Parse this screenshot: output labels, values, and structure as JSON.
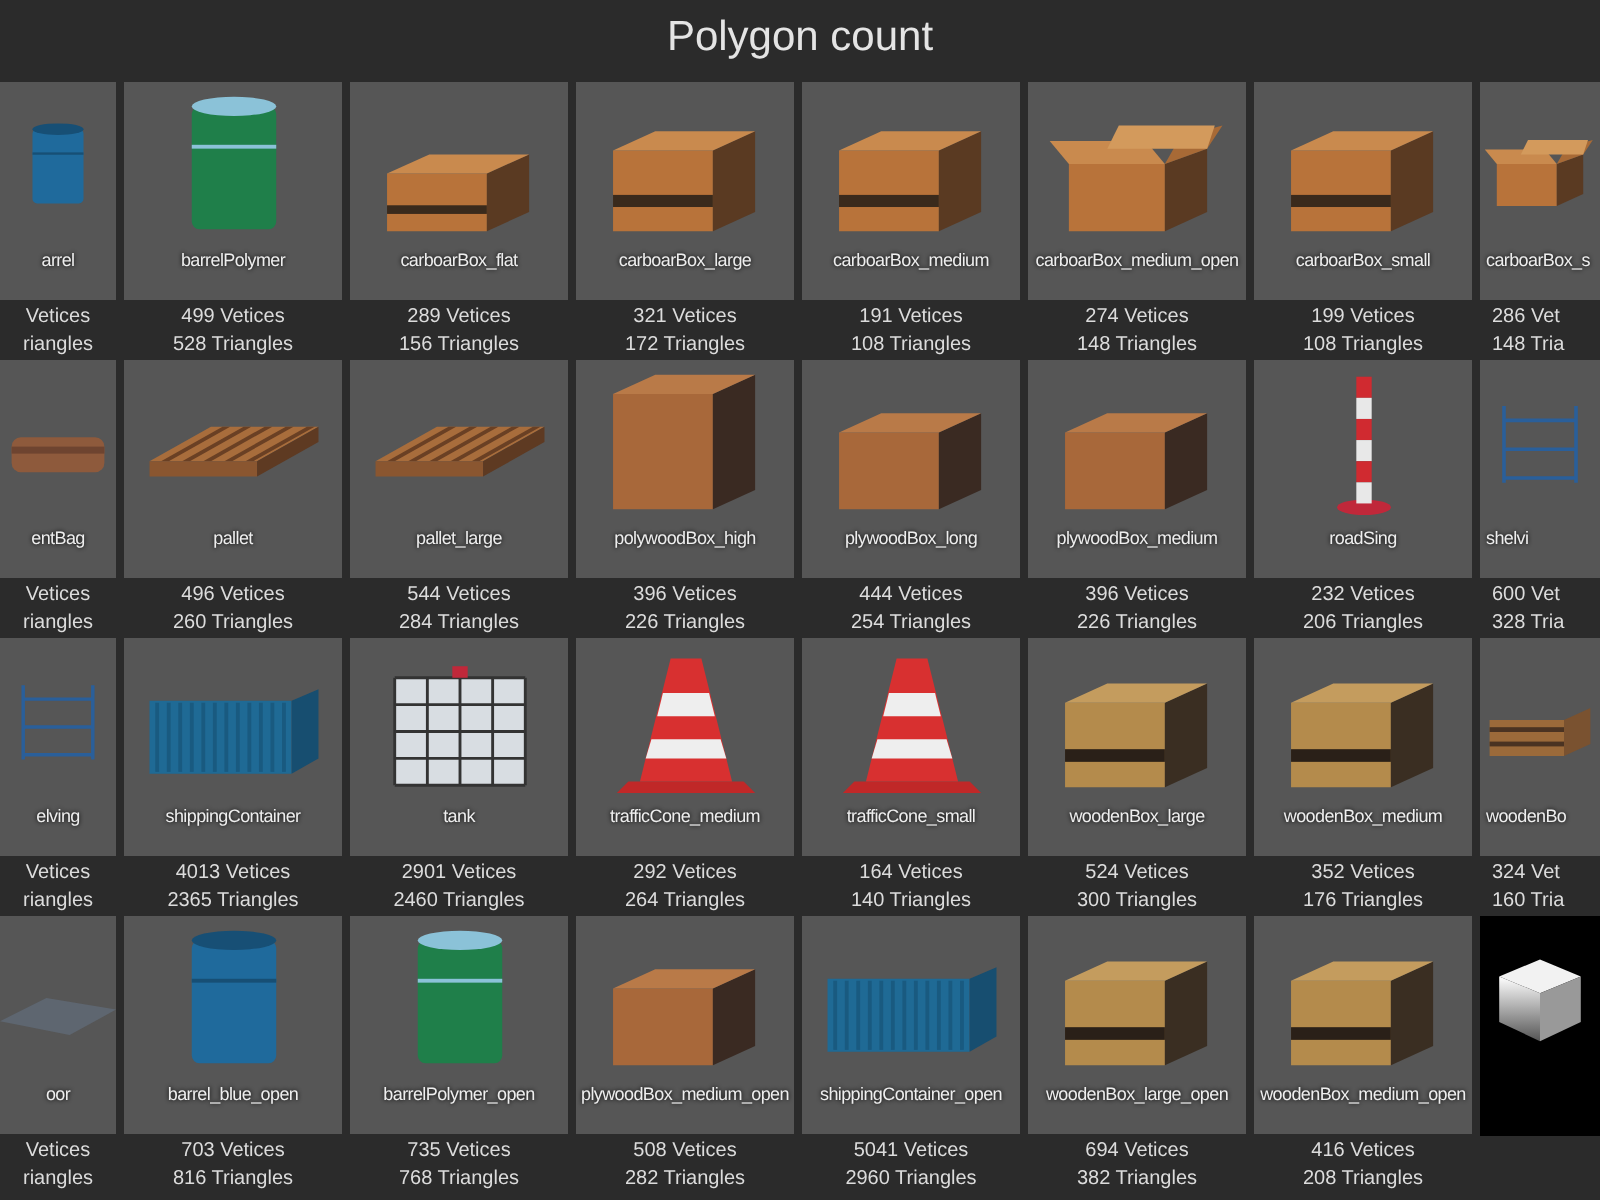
{
  "title": "Polygon count",
  "rows": [
    [
      {
        "kind": "barrel",
        "name": "arrel",
        "vertices": "Vetices",
        "triangles": "riangles"
      },
      {
        "kind": "drum",
        "name": "barrelPolymer",
        "vertices": "499 Vetices",
        "triangles": "528 Triangles"
      },
      {
        "kind": "flatbox",
        "name": "carboarBox_flat",
        "vertices": "289 Vetices",
        "triangles": "156 Triangles"
      },
      {
        "kind": "box",
        "name": "carboarBox_large",
        "vertices": "321 Vetices",
        "triangles": "172 Triangles"
      },
      {
        "kind": "box",
        "name": "carboarBox_medium",
        "vertices": "191 Vetices",
        "triangles": "108 Triangles"
      },
      {
        "kind": "openbox",
        "name": "carboarBox_medium_open",
        "vertices": "274 Vetices",
        "triangles": "148 Triangles"
      },
      {
        "kind": "box",
        "name": "carboarBox_small",
        "vertices": "199 Vetices",
        "triangles": "108 Triangles"
      },
      {
        "kind": "openbox",
        "name": "carboarBox_s",
        "vertices": "286 Vet",
        "triangles": "148 Tria"
      }
    ],
    [
      {
        "kind": "bag",
        "name": "entBag",
        "vertices": "Vetices",
        "triangles": "riangles"
      },
      {
        "kind": "pallet",
        "name": "pallet",
        "vertices": "496 Vetices",
        "triangles": "260 Triangles"
      },
      {
        "kind": "pallet",
        "name": "pallet_large",
        "vertices": "544 Vetices",
        "triangles": "284 Triangles"
      },
      {
        "kind": "tallcrate",
        "name": "polywoodBox_high",
        "vertices": "396 Vetices",
        "triangles": "226 Triangles"
      },
      {
        "kind": "crate",
        "name": "plywoodBox_long",
        "vertices": "444 Vetices",
        "triangles": "254 Triangles"
      },
      {
        "kind": "crate",
        "name": "plywoodBox_medium",
        "vertices": "396 Vetices",
        "triangles": "226 Triangles"
      },
      {
        "kind": "post",
        "name": "roadSing",
        "vertices": "232 Vetices",
        "triangles": "206 Triangles"
      },
      {
        "kind": "shelf",
        "name": "shelvi",
        "vertices": "600 Vet",
        "triangles": "328 Tria"
      }
    ],
    [
      {
        "kind": "shelf",
        "name": "elving",
        "vertices": "Vetices",
        "triangles": "riangles"
      },
      {
        "kind": "container",
        "name": "shippingContainer",
        "vertices": "4013 Vetices",
        "triangles": "2365 Triangles"
      },
      {
        "kind": "tank",
        "name": "tank",
        "vertices": "2901 Vetices",
        "triangles": "2460 Triangles"
      },
      {
        "kind": "cone",
        "name": "trafficCone_medium",
        "vertices": "292 Vetices",
        "triangles": "264 Triangles"
      },
      {
        "kind": "cone",
        "name": "trafficCone_small",
        "vertices": "164 Vetices",
        "triangles": "140 Triangles"
      },
      {
        "kind": "woodbox",
        "name": "woodenBox_large",
        "vertices": "524 Vetices",
        "triangles": "300 Triangles"
      },
      {
        "kind": "woodbox",
        "name": "woodenBox_medium",
        "vertices": "352 Vetices",
        "triangles": "176 Triangles"
      },
      {
        "kind": "slatcrate",
        "name": "woodenBo",
        "vertices": "324 Vet",
        "triangles": "160 Tria"
      }
    ],
    [
      {
        "kind": "floor",
        "name": "oor",
        "vertices": "Vetices",
        "triangles": "riangles"
      },
      {
        "kind": "barrel",
        "name": "barrel_blue_open",
        "vertices": "703 Vetices",
        "triangles": "816 Triangles"
      },
      {
        "kind": "drum",
        "name": "barrelPolymer_open",
        "vertices": "735 Vetices",
        "triangles": "768 Triangles"
      },
      {
        "kind": "crate",
        "name": "plywoodBox_medium_open",
        "vertices": "508 Vetices",
        "triangles": "282 Triangles"
      },
      {
        "kind": "container",
        "name": "shippingContainer_open",
        "vertices": "5041 Vetices",
        "triangles": "2960 Triangles"
      },
      {
        "kind": "woodbox",
        "name": "woodenBox_large_open",
        "vertices": "694 Vetices",
        "triangles": "382 Triangles"
      },
      {
        "kind": "woodbox",
        "name": "woodenBox_medium_open",
        "vertices": "416 Vetices",
        "triangles": "208 Triangles"
      },
      {
        "kind": "cube"
      }
    ]
  ]
}
